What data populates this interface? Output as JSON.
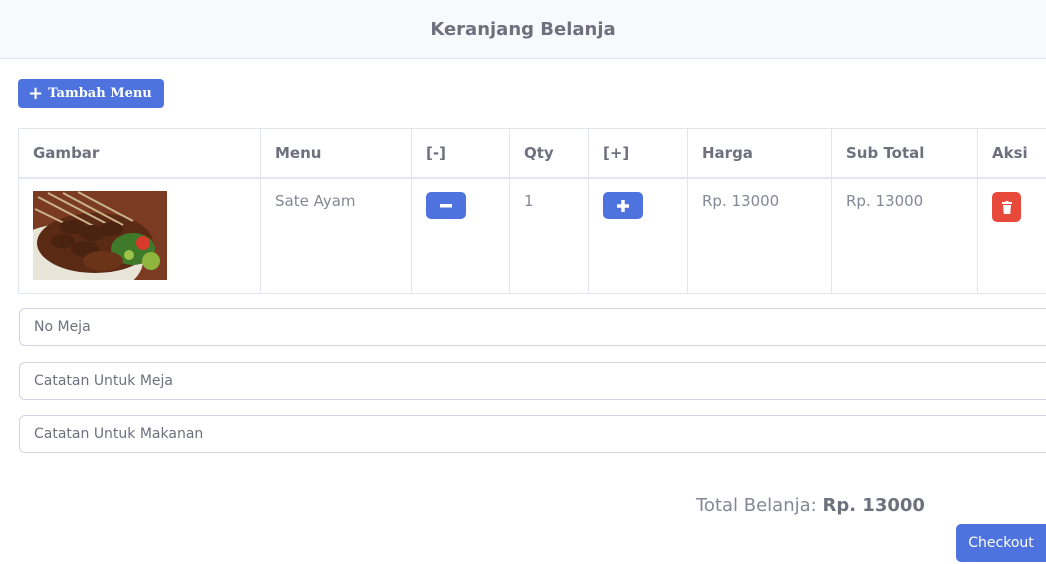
{
  "header": {
    "title": "Keranjang Belanja"
  },
  "toolbar": {
    "add_menu_label": "Tambah Menu"
  },
  "table": {
    "columns": [
      "Gambar",
      "Menu",
      "[-]",
      "Qty",
      "[+]",
      "Harga",
      "Sub Total",
      "Aksi"
    ],
    "rows": [
      {
        "image": "sate-ayam-photo",
        "menu": "Sate Ayam",
        "qty": "1",
        "harga": "Rp. 13000",
        "subtotal": "Rp. 13000"
      }
    ]
  },
  "form": {
    "no_meja_placeholder": "No Meja",
    "catatan_meja_placeholder": "Catatan Untuk Meja",
    "catatan_makanan_placeholder": "Catatan Untuk Makanan"
  },
  "summary": {
    "total_label": "Total Belanja:",
    "total_value": "Rp. 13000"
  },
  "actions": {
    "checkout_label": "Checkout"
  },
  "colors": {
    "primary": "#4e73df",
    "danger": "#e74a3b",
    "header_bg": "#f8f9fc",
    "text": "#858796"
  },
  "icons": {
    "add": "plus-icon",
    "decrease": "minus-icon",
    "increase": "plus-icon",
    "delete": "trash-icon"
  }
}
